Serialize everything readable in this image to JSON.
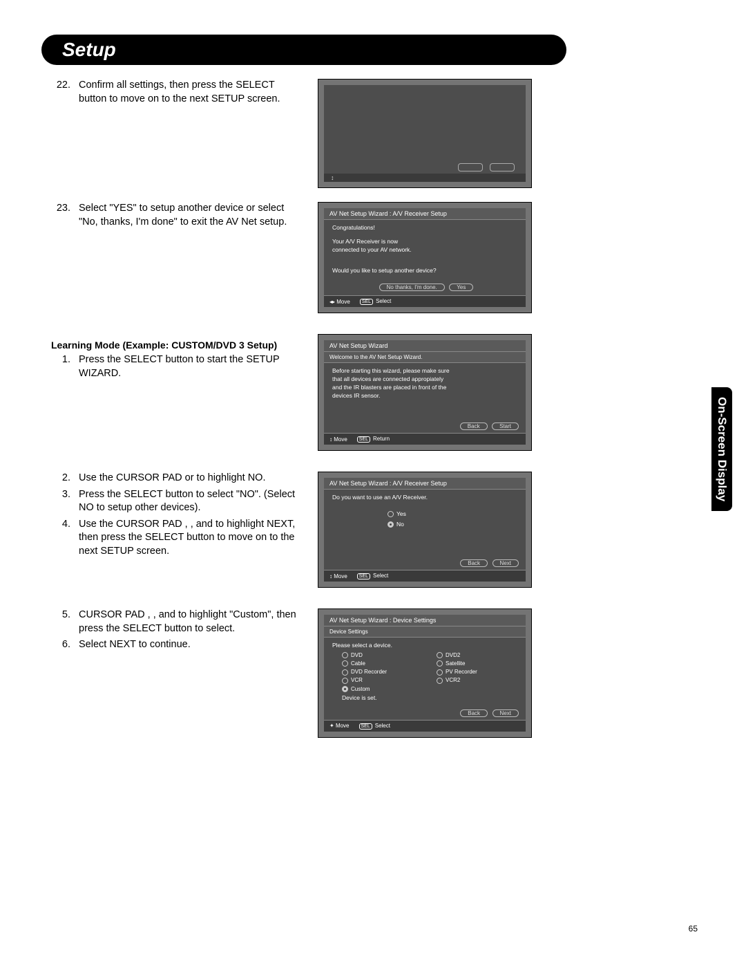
{
  "page": {
    "title": "Setup",
    "side_tab": "On-Screen Display",
    "page_number": "65"
  },
  "steps_top": [
    {
      "num": "22.",
      "text": "Confirm all settings, then press the SELECT button to move on to the next SETUP screen."
    },
    {
      "num": "23.",
      "text": "Select \"YES\" to setup another device or select \"No, thanks, I'm done\" to exit the AV Net setup."
    }
  ],
  "subheading": "Learning Mode (Example:  CUSTOM/DVD 3 Setup)",
  "steps_a": [
    {
      "num": "1.",
      "text": "Press the SELECT button to start the SETUP WIZARD."
    }
  ],
  "steps_b": [
    {
      "num": "2.",
      "text": "Use the CURSOR PAD     or     to highlight NO."
    },
    {
      "num": "3.",
      "text": "Press the SELECT button to select \"NO\". (Select NO to setup other devices)."
    },
    {
      "num": "4.",
      "text": "Use the CURSOR PAD   ,   ,     and     to highlight NEXT, then press the SELECT button to move on to the next SETUP screen."
    }
  ],
  "steps_c": [
    {
      "num": "5.",
      "text": "CURSOR PAD   ,   ,     and     to highlight \"Custom\", then press the SELECT button to select."
    },
    {
      "num": "6.",
      "text": "Select NEXT to continue."
    }
  ],
  "osd23": {
    "header": "AV Net Setup Wizard : A/V Receiver Setup",
    "line1": "Congratulations!",
    "line2": "Your A/V Receiver is now",
    "line3": "connected to your AV network.",
    "question": "Would you like to setup another device?",
    "btn_no": "No thanks, I'm done.",
    "btn_yes": "Yes",
    "footer_move": "Move",
    "footer_select": "Select"
  },
  "osd1": {
    "header": "AV Net Setup Wizard",
    "sub": "Welcome to the AV Net Setup Wizard.",
    "line1": "Before starting this wizard, please make sure",
    "line2": "that all devices are connected appropiately",
    "line3": "and the IR blasters are placed in front of the",
    "line4": "devices IR sensor.",
    "btn_back": "Back",
    "btn_start": "Start",
    "footer_move": "Move",
    "footer_return": "Return"
  },
  "osd2": {
    "header": "AV Net Setup Wizard : A/V Receiver Setup",
    "question": "Do you want to use an A/V Receiver.",
    "opt_yes": "Yes",
    "opt_no": "No",
    "btn_back": "Back",
    "btn_next": "Next",
    "footer_move": "Move",
    "footer_select": "Select"
  },
  "osd3": {
    "header": "AV Net Setup Wizard : Device Settings",
    "sub": "Device Settings",
    "prompt": "Please select a device.",
    "devices": [
      "DVD",
      "DVD2",
      "Cable",
      "Satellite",
      "DVD Recorder",
      "PV Recorder",
      "VCR",
      "VCR2",
      "Custom",
      ""
    ],
    "device_set": "Device is set.",
    "btn_back": "Back",
    "btn_next": "Next",
    "footer_move": "Move",
    "footer_select": "Select"
  }
}
